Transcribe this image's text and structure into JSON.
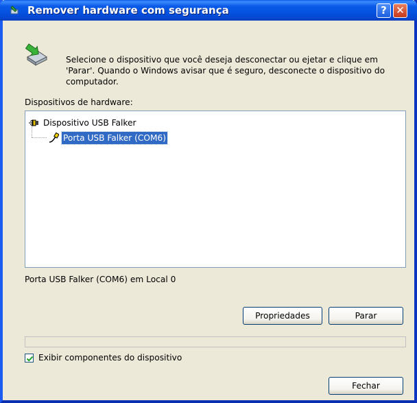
{
  "window": {
    "title": "Remover hardware com segurança",
    "help_label": "?",
    "close_label": "✕"
  },
  "description": "Selecione o dispositivo que você deseja desconectar ou ejetar e clique em 'Parar'. Quando o Windows avisar que é seguro, desconecte o dispositivo do computador.",
  "hardware": {
    "label": "Dispositivos de hardware:",
    "tree": [
      {
        "label": "Dispositivo USB Falker",
        "icon": "usb-device-icon",
        "selected": false
      },
      {
        "label": "Porta USB Falker (COM6)",
        "icon": "port-icon",
        "selected": true
      }
    ]
  },
  "status_text": "Porta USB Falker (COM6) em Local 0",
  "buttons": {
    "properties": "Propriedades",
    "stop": "Parar",
    "close": "Fechar"
  },
  "options": {
    "show_components_label": "Exibir componentes do dispositivo",
    "show_components_checked": true
  },
  "colors": {
    "titlebar": "#0553e0",
    "selection": "#316ac5",
    "dialog_bg": "#ece9d8"
  }
}
